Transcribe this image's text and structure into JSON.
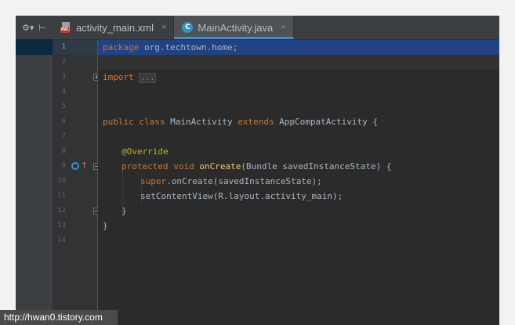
{
  "tabs": [
    {
      "label": "activity_main.xml",
      "icon": "xml-file-icon",
      "active": false
    },
    {
      "label": "MainActivity.java",
      "icon": "java-class-icon",
      "active": true
    }
  ],
  "tab_close_glyph": "×",
  "class_icon_letter": "C",
  "xml_badge": "XML",
  "toolbar": {
    "settings_glyph": "⚙▾",
    "collapse_glyph": "⊢"
  },
  "editor": {
    "current_line": 1,
    "lines": [
      {
        "n": "1"
      },
      {
        "n": "2"
      },
      {
        "n": "3"
      },
      {
        "n": "4"
      },
      {
        "n": "5"
      },
      {
        "n": "6"
      },
      {
        "n": "7"
      },
      {
        "n": "8"
      },
      {
        "n": "9"
      },
      {
        "n": "10"
      },
      {
        "n": "11"
      },
      {
        "n": "12"
      },
      {
        "n": "13"
      },
      {
        "n": "14"
      }
    ],
    "code": {
      "l1_kw": "package",
      "l1_rest": " org.techtown.home;",
      "l3_kw": "import",
      "l3_fold": "...",
      "l6_kw1": "public class",
      "l6_name": " MainActivity ",
      "l6_kw2": "extends",
      "l6_rest": " AppCompatActivity {",
      "l8_ann": "@Override",
      "l9_kw": "protected void",
      "l9_fn": "onCreate",
      "l9_rest": "(Bundle savedInstanceState) {",
      "l10_kw": "super",
      "l10_rest": ".onCreate(savedInstanceState);",
      "l11_text": "setContentView(R.layout.activity_main);",
      "l12_text": "}",
      "l13_text": "}"
    }
  },
  "colors": {
    "keyword": "#cc7832",
    "annotation": "#bbb529",
    "method": "#ffc66d",
    "text": "#a9b7c6",
    "selection": "#214283",
    "accent": "#4a88c7"
  },
  "watermark": "http://hwan0.tistory.com"
}
